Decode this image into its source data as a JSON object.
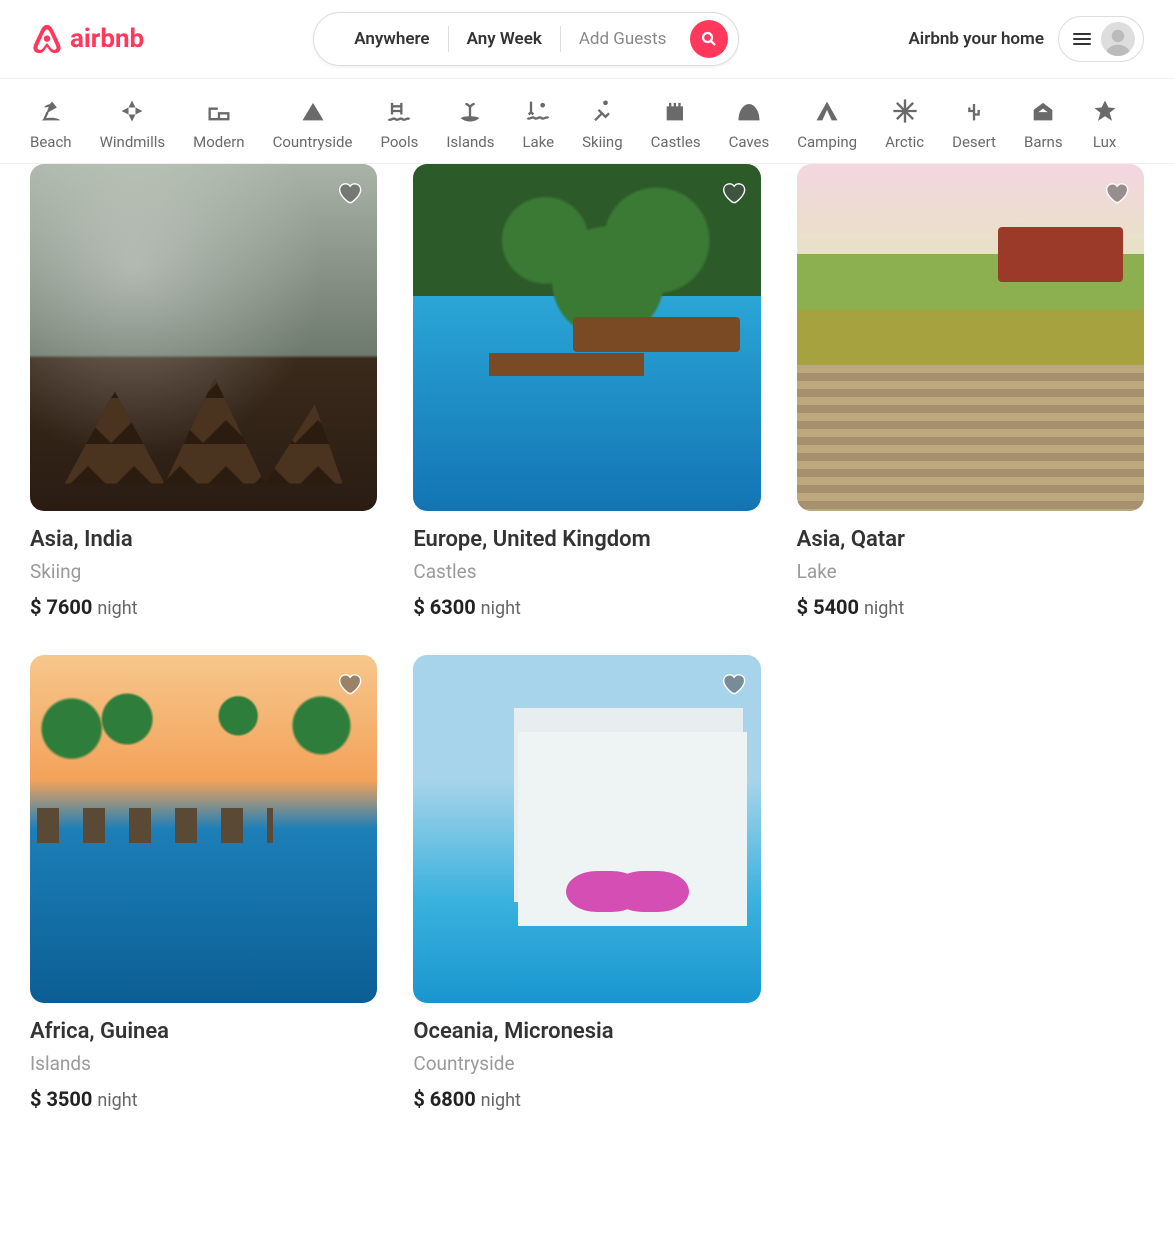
{
  "header": {
    "brand": "airbnb",
    "search": {
      "where": "Anywhere",
      "when": "Any Week",
      "who": "Add Guests"
    },
    "host_cta": "Airbnb your home"
  },
  "categories": [
    {
      "label": "Beach",
      "icon": "beach"
    },
    {
      "label": "Windmills",
      "icon": "windmill"
    },
    {
      "label": "Modern",
      "icon": "modern"
    },
    {
      "label": "Countryside",
      "icon": "mountain"
    },
    {
      "label": "Pools",
      "icon": "pool"
    },
    {
      "label": "Islands",
      "icon": "island"
    },
    {
      "label": "Lake",
      "icon": "lake"
    },
    {
      "label": "Skiing",
      "icon": "ski"
    },
    {
      "label": "Castles",
      "icon": "castle"
    },
    {
      "label": "Caves",
      "icon": "cave"
    },
    {
      "label": "Camping",
      "icon": "camping"
    },
    {
      "label": "Arctic",
      "icon": "arctic"
    },
    {
      "label": "Desert",
      "icon": "desert"
    },
    {
      "label": "Barns",
      "icon": "barn"
    },
    {
      "label": "Lux",
      "icon": "lux"
    }
  ],
  "per_label": "night",
  "currency": "$",
  "listings": [
    {
      "title": "Asia, India",
      "subtitle": "Skiing",
      "price": 7600,
      "img": "img-india"
    },
    {
      "title": "Europe, United Kingdom",
      "subtitle": "Castles",
      "price": 6300,
      "img": "img-uk"
    },
    {
      "title": "Asia, Qatar",
      "subtitle": "Lake",
      "price": 5400,
      "img": "img-qatar"
    },
    {
      "title": "Africa, Guinea",
      "subtitle": "Islands",
      "price": 3500,
      "img": "img-guinea"
    },
    {
      "title": "Oceania, Micronesia",
      "subtitle": "Countryside",
      "price": 6800,
      "img": "img-micronesia"
    }
  ]
}
